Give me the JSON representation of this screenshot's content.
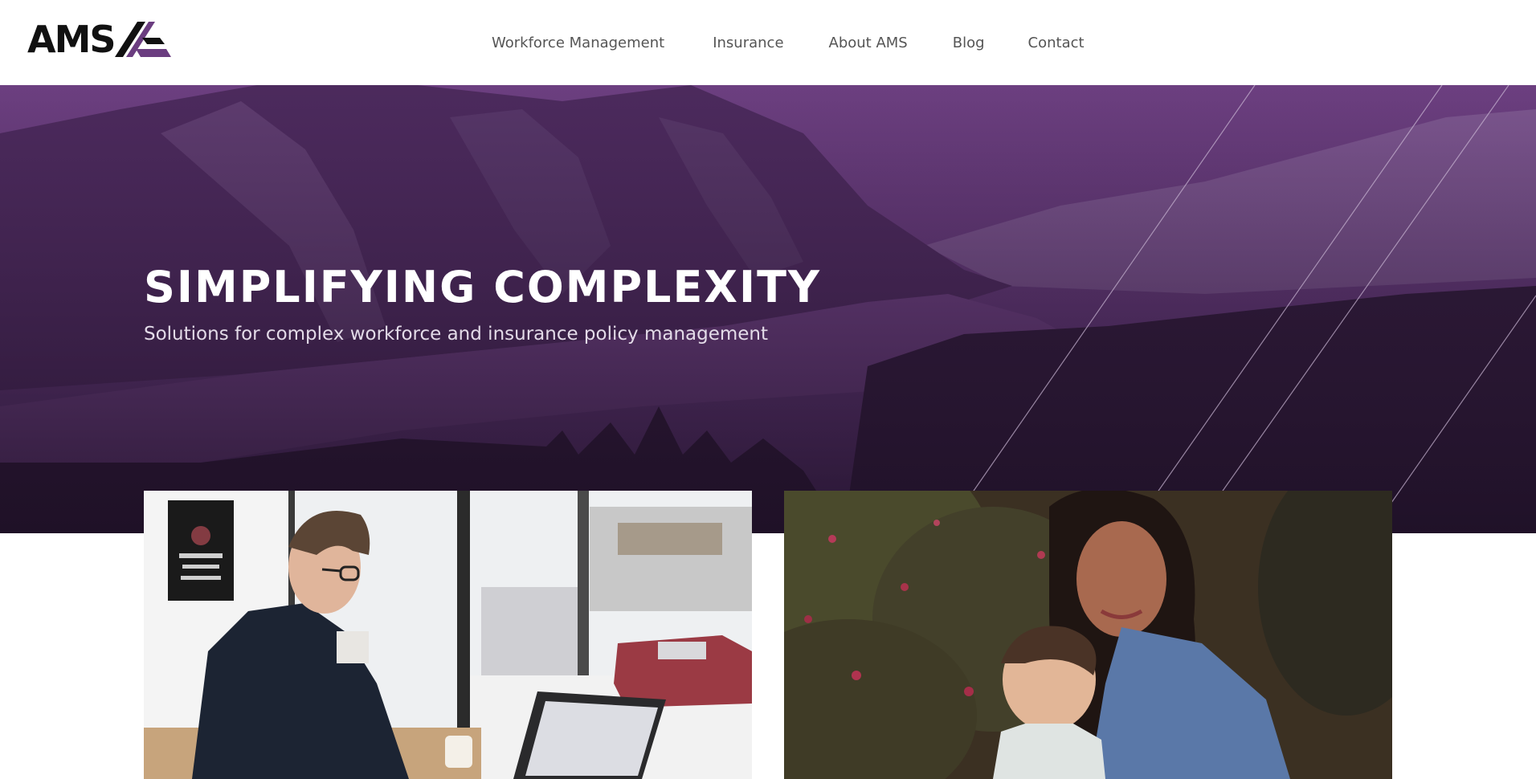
{
  "brand": {
    "name": "AMS",
    "accent_color": "#6b3d80"
  },
  "nav": {
    "items": [
      {
        "label": "Workforce Management"
      },
      {
        "label": "Insurance"
      },
      {
        "label": "About AMS"
      },
      {
        "label": "Blog"
      },
      {
        "label": "Contact"
      }
    ]
  },
  "hero": {
    "title": "SIMPLIFYING COMPLEXITY",
    "subtitle": "Solutions for complex workforce and insurance policy management"
  },
  "cards": [
    {
      "image": "man-working-on-laptop-photo"
    },
    {
      "image": "mother-and-child-photo"
    }
  ]
}
